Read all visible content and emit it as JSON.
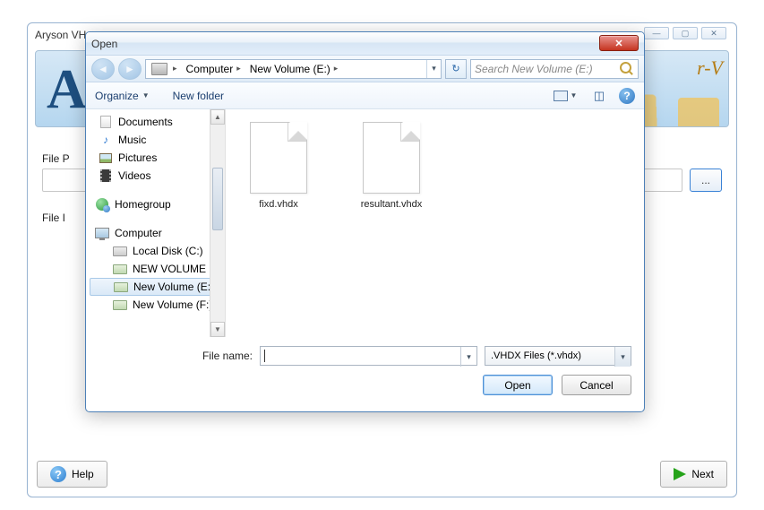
{
  "app": {
    "title_fragment": "Aryson VH",
    "banner_letters": "AE",
    "banner_right": "r-V",
    "file_path_label": "File P",
    "file_info_label": "File I",
    "browse_label": "...",
    "help_label": "Help",
    "next_label": "Next"
  },
  "dialog": {
    "title": "Open",
    "breadcrumb": {
      "seg1": "Computer",
      "seg2": "New Volume (E:)"
    },
    "search_placeholder": "Search New Volume (E:)",
    "toolbar": {
      "organize": "Organize",
      "newfolder": "New folder"
    },
    "tree": {
      "documents": "Documents",
      "music": "Music",
      "pictures": "Pictures",
      "videos": "Videos",
      "homegroup": "Homegroup",
      "computer": "Computer",
      "local_c": "Local Disk (C:)",
      "vol_d": "NEW VOLUME (D",
      "vol_e": "New Volume (E:)",
      "vol_f": "New Volume (F:)"
    },
    "files": [
      {
        "name": "fixd.vhdx"
      },
      {
        "name": "resultant.vhdx"
      }
    ],
    "filename_label": "File name:",
    "filter_label": ".VHDX Files (*.vhdx)",
    "open_btn": "Open",
    "cancel_btn": "Cancel"
  }
}
